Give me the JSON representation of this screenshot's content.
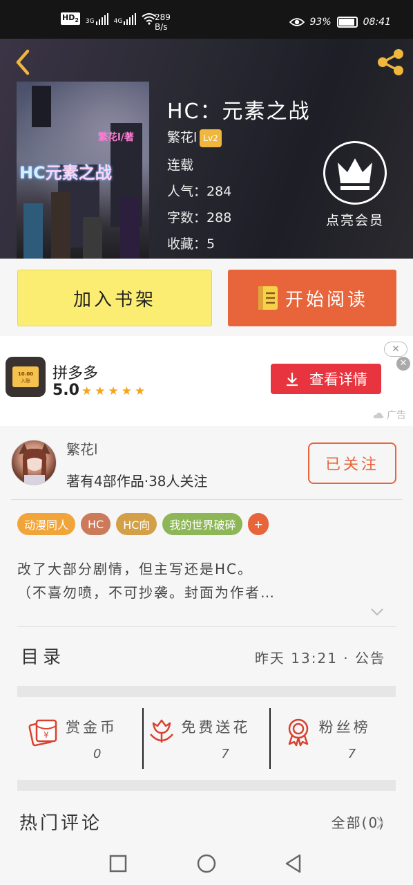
{
  "status_bar": {
    "hd_label": "HD",
    "hd_sub": "2",
    "net1": "3G",
    "net2": "4G",
    "speed_value": "289",
    "speed_unit": "B/s",
    "battery_pct": "93%",
    "battery_level": 0.93,
    "time": "08:41"
  },
  "book": {
    "title": "HC：元素之战",
    "author": "繁花l",
    "level": "Lv2",
    "status": "连载",
    "popularity_label": "人气：",
    "popularity": "284",
    "words_label": "字数：",
    "words": "288",
    "favorites_label": "收藏：",
    "favorites": "5",
    "cover_author": "繁花l/著",
    "cover_title_a": "HC",
    "cover_title_b": "元素之战",
    "vip_label": "点亮会员"
  },
  "actions": {
    "add_shelf": "加入书架",
    "start_read": "开始阅读"
  },
  "ad": {
    "app_name": "拼多多",
    "score": "5.0",
    "stars": "★★★★★",
    "icon_text_top": "10.00",
    "icon_text_bottom": "入账",
    "cta": "查看详情",
    "close_small": "✕",
    "close_x": "✕",
    "tag": "广告"
  },
  "author": {
    "name": "繁花l",
    "stats": "著有4部作品·38人关注",
    "follow_label": "已关注"
  },
  "tags": [
    {
      "label": "动漫同人",
      "color": "#f1a43a"
    },
    {
      "label": "HC",
      "color": "#cc7a5a"
    },
    {
      "label": "HC向",
      "color": "#d3a047"
    },
    {
      "label": "我的世界破碎",
      "color": "#8db656"
    },
    {
      "label": "+",
      "color": "#e8643a"
    }
  ],
  "description": {
    "line1": "改了大部分剧情，但主写还是HC。",
    "line2": "（不喜勿喷，不可抄袭。封面为作者…"
  },
  "toc": {
    "title": "目录",
    "meta": "昨天 13:21 · 公告"
  },
  "support": [
    {
      "label": "赏金币",
      "value": "0"
    },
    {
      "label": "免费送花",
      "value": "7"
    },
    {
      "label": "粉丝榜",
      "value": "7"
    }
  ],
  "comments": {
    "title": "热门评论",
    "all": "全部(0)"
  },
  "colors": {
    "accent": "#e8643a",
    "shelf_button": "#fbed72",
    "level_badge": "#f0b63d",
    "ad_button": "#e8343e",
    "icon_red": "#d9412e"
  }
}
